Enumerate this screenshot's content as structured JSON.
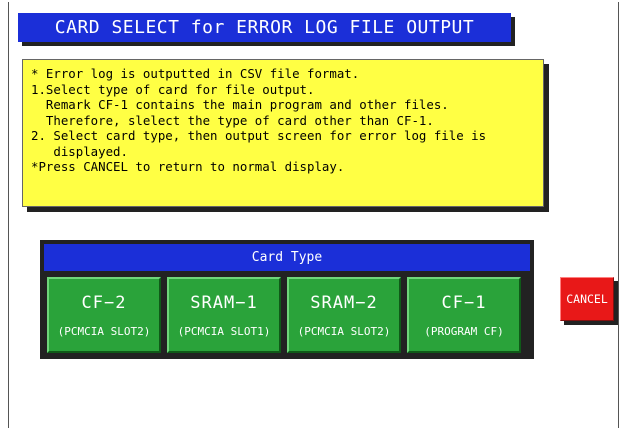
{
  "title": "CARD SELECT for ERROR LOG FILE OUTPUT",
  "notes": [
    "* Error log is outputted in CSV file format.",
    "1.Select type of card for file output.",
    "  Remark CF-1 contains the main program and other files.",
    "  Therefore, slelect the type of card other than CF-1.",
    "2. Select card type, then output screen for error log file is",
    "   displayed.",
    "*Press CANCEL to return to normal display."
  ],
  "card_panel": {
    "header": "Card Type",
    "cards": [
      {
        "label": "CF−2",
        "sub": "(PCMCIA SLOT2)"
      },
      {
        "label": "SRAM−1",
        "sub": "(PCMCIA SLOT1)"
      },
      {
        "label": "SRAM−2",
        "sub": "(PCMCIA SLOT2)"
      },
      {
        "label": "CF−1",
        "sub": "(PROGRAM CF)"
      }
    ]
  },
  "cancel_label": "CANCEL",
  "colors": {
    "title_bg": "#1b2fd8",
    "note_bg": "#ffff44",
    "card_bg": "#2aa33a",
    "cancel_bg": "#e81818"
  }
}
